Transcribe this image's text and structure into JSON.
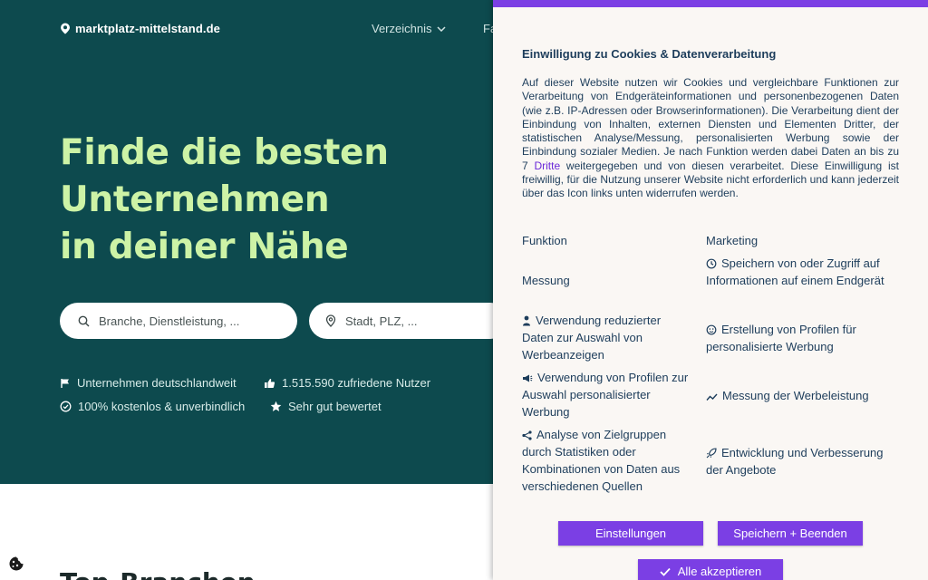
{
  "site": {
    "logo_text": "marktplatz-mittelstand.de",
    "nav": [
      {
        "label": "Verzeichnis"
      },
      {
        "label": "Fa"
      }
    ]
  },
  "hero": {
    "headline_lines": [
      "Finde die besten",
      "Unternehmen",
      "in deiner Nähe"
    ],
    "search_what_placeholder": "Branche, Dienstleistung, ...",
    "search_where_placeholder": "Stadt, PLZ, ...",
    "features": [
      {
        "icon": "flag-icon",
        "label": "Unternehmen deutschlandweit"
      },
      {
        "icon": "thumbs-up-icon",
        "label": "1.515.590 zufriedene Nutzer"
      },
      {
        "icon": "check-circle-icon",
        "label": "100% kostenlos & unverbindlich"
      },
      {
        "icon": "star-icon",
        "label": "Sehr gut bewertet"
      }
    ]
  },
  "below": {
    "title_partial": "Top-Branchen"
  },
  "consent": {
    "title": "Einwilligung zu Cookies & Datenverarbeitung",
    "text_before_link": "Auf dieser Website nutzen wir Cookies und vergleichbare Funktionen zur Verarbeitung von Endgeräteinformationen und personenbezogenen Daten (wie z.B. IP-Adressen oder Browserinformationen). Die Verarbeitung dient der Einbindung von Inhalten, externen Diensten und Elementen Dritter, der statistischen Analyse/Messung, personalisierten Werbung sowie der Einbindung sozialer Medien. Je nach Funktion werden dabei Daten an bis zu 7 ",
    "link_label": "Dritte",
    "text_after_link": " weitergegeben und von diesen verarbeitet. Diese Einwilligung ist freiwillig, für die Nutzung unserer Website nicht erforderlich und kann jederzeit über das Icon links unten widerrufen werden.",
    "purposes": {
      "funktion": "Funktion",
      "marketing": "Marketing",
      "messung": "Messung",
      "speichern": "Speichern von oder Zugriff auf Informationen auf einem Endgerät",
      "reduzierte_daten": "Verwendung reduzierter Daten zur Auswahl von Werbeanzeigen",
      "profile_erstellung": "Erstellung von Profilen für personalisierte Werbung",
      "profile_verwendung": "Verwendung von Profilen zur Auswahl personalisierter Werbung",
      "werbeleistung": "Messung der Werbeleistung",
      "zielgruppen": "Analyse von Zielgruppen durch Statistiken oder Kombinationen von Daten aus verschiedenen Quellen",
      "entwicklung": "Entwicklung und Verbesserung der Angebote"
    },
    "buttons": {
      "settings": "Einstellungen",
      "save": "Speichern + Beenden",
      "accept_all": "Alle akzeptieren"
    }
  },
  "colors": {
    "hero_bg": "#0d4a4e",
    "headline": "#cdf3a6",
    "accent_purple": "#7b3fe4",
    "consent_bg": "#faf7f4",
    "consent_text": "#1d3d5b"
  }
}
